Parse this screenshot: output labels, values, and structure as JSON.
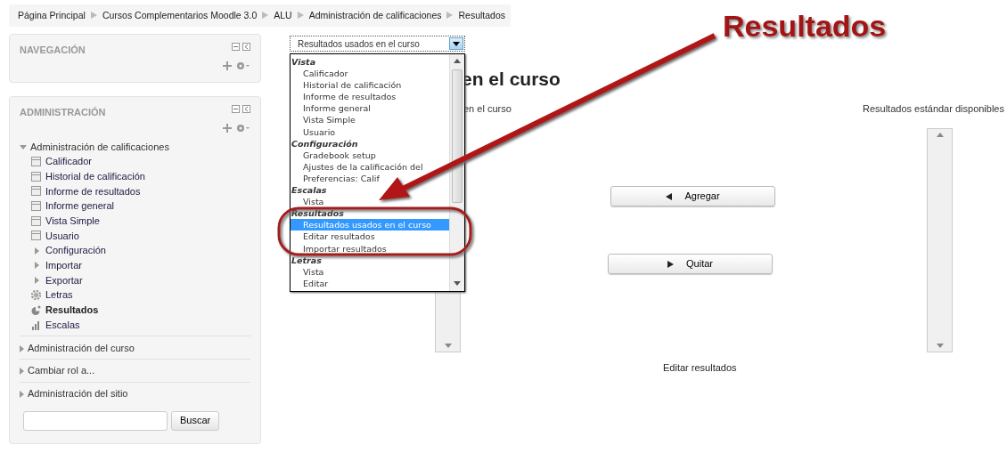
{
  "breadcrumb": [
    "Página Principal",
    "Cursos Complementarios Moodle 3.0",
    "ALU",
    "Administración de calificaciones",
    "Resultados"
  ],
  "navigation_block": {
    "title": "NAVEGACIÓN"
  },
  "administration_block": {
    "title": "ADMINISTRACIÓN",
    "tree": [
      {
        "label": "Administración de calificaciones",
        "expanded": true,
        "children": [
          {
            "label": "Calificador",
            "kind": "page",
            "selected": false
          },
          {
            "label": "Historial de calificación",
            "kind": "page",
            "selected": false
          },
          {
            "label": "Informe de resultados",
            "kind": "page",
            "selected": false
          },
          {
            "label": "Informe general",
            "kind": "page",
            "selected": false
          },
          {
            "label": "Vista Simple",
            "kind": "page",
            "selected": false
          },
          {
            "label": "Usuario",
            "kind": "page",
            "selected": false
          },
          {
            "label": "Configuración",
            "kind": "branch",
            "selected": false
          },
          {
            "label": "Importar",
            "kind": "branch",
            "selected": false
          },
          {
            "label": "Exportar",
            "kind": "branch",
            "selected": false
          },
          {
            "label": "Letras",
            "kind": "gear",
            "selected": false
          },
          {
            "label": "Resultados",
            "kind": "outcome",
            "selected": true
          },
          {
            "label": "Escalas",
            "kind": "chart",
            "selected": false
          }
        ]
      },
      {
        "label": "Administración del curso",
        "expanded": false
      },
      {
        "label": "Cambiar rol a...",
        "expanded": false
      },
      {
        "label": "Administración del sitio",
        "expanded": false
      }
    ],
    "search_button": "Buscar"
  },
  "report_select": {
    "value": "Resultados usados en el curso",
    "groups": [
      {
        "label": "Vista",
        "options": [
          {
            "label": "Calificador",
            "selected": false
          },
          {
            "label": "Historial de calificación",
            "selected": false
          },
          {
            "label": "Informe de resultados",
            "selected": false
          },
          {
            "label": "Informe general",
            "selected": false
          },
          {
            "label": "Vista Simple",
            "selected": false
          },
          {
            "label": "Usuario",
            "selected": false
          }
        ]
      },
      {
        "label": "Configuración",
        "options": [
          {
            "label": "Gradebook setup",
            "selected": false
          },
          {
            "label": "Ajustes de la calificación del",
            "selected": false
          },
          {
            "label": "Preferencias: Calif",
            "selected": false
          }
        ]
      },
      {
        "label": "Escalas",
        "options": [
          {
            "label": "Vista",
            "selected": false
          }
        ]
      },
      {
        "label": "Resultados",
        "options": [
          {
            "label": "Resultados usados en el curso",
            "selected": true
          },
          {
            "label": "Editar resultados",
            "selected": false
          },
          {
            "label": "Importar resultados",
            "selected": false
          }
        ]
      },
      {
        "label": "Letras",
        "options": [
          {
            "label": "Vista",
            "selected": false
          },
          {
            "label": "Editar",
            "selected": false
          }
        ]
      }
    ]
  },
  "heading": "en el curso",
  "left_list_label": "en el curso",
  "right_list_label": "Resultados estándar disponibles",
  "buttons": [
    {
      "label": "Agregar",
      "kind": "add"
    },
    {
      "label": "Quitar",
      "kind": "remove"
    }
  ],
  "edit_link": "Editar resultados",
  "annotation": {
    "callout": "Resultados"
  }
}
